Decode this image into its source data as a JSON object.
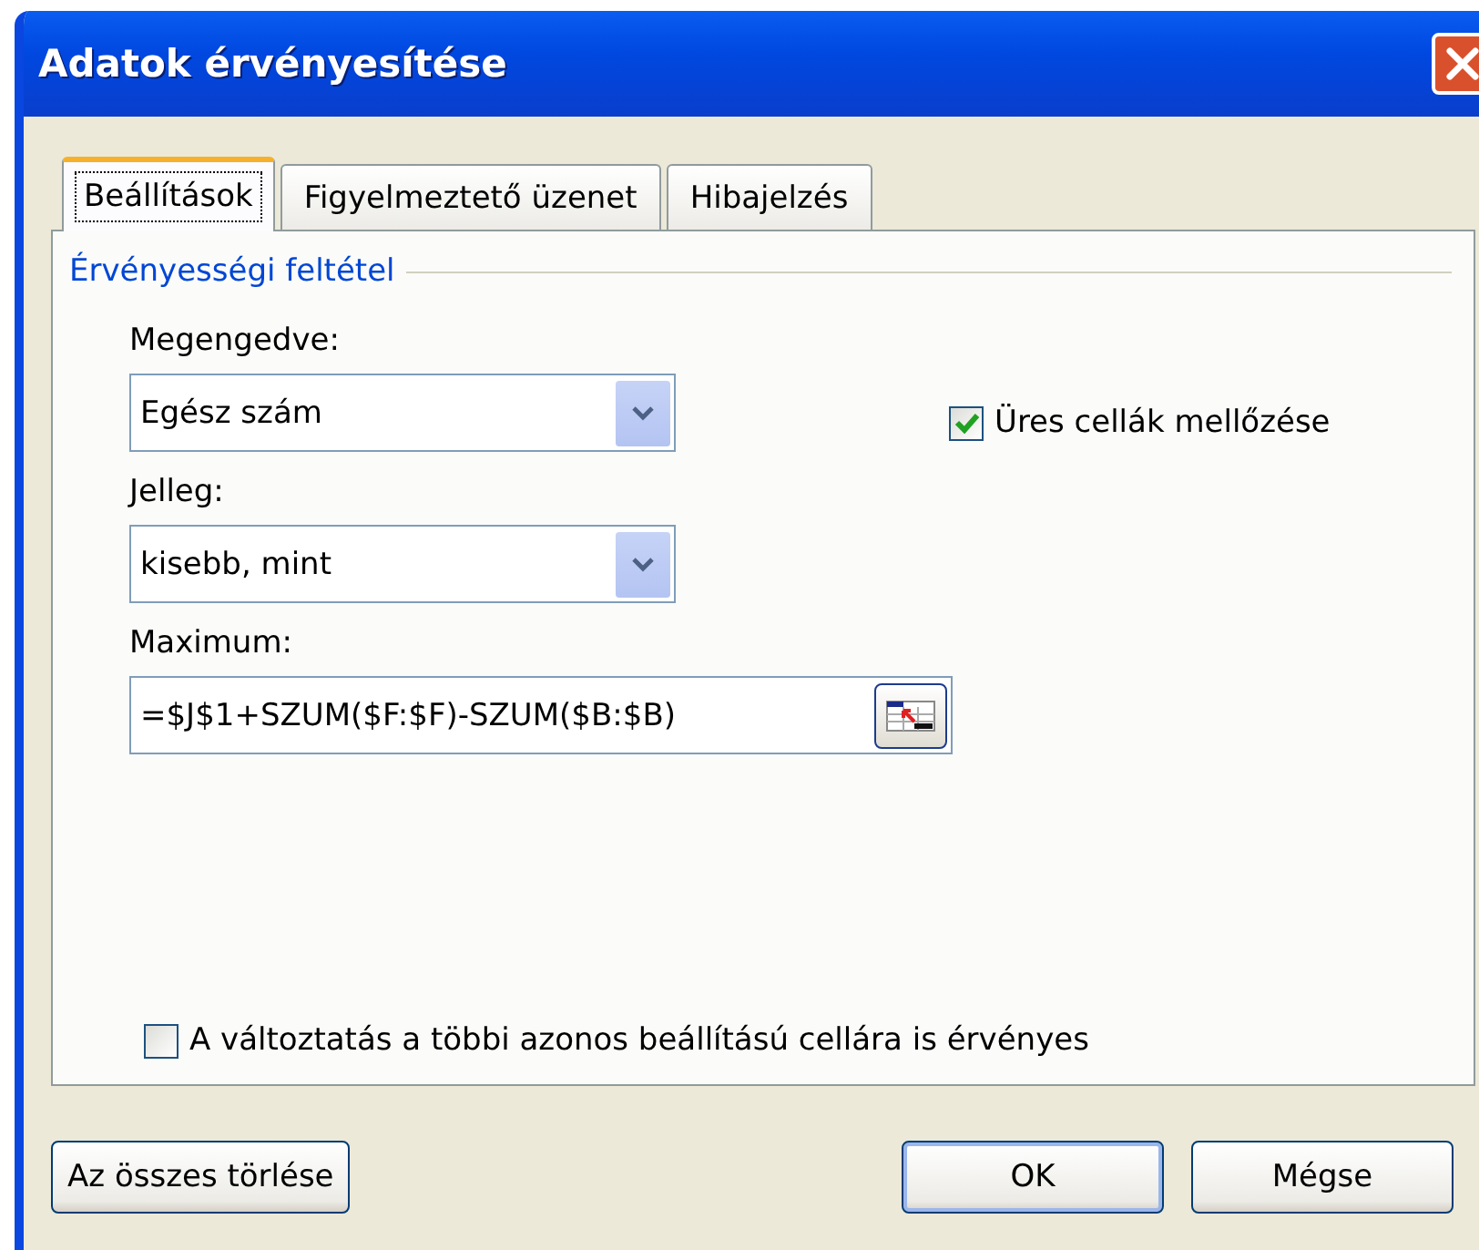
{
  "window": {
    "title": "Adatok érvényesítése"
  },
  "tabs": [
    {
      "label": "Beállítások",
      "selected": true
    },
    {
      "label": "Figyelmeztető üzenet",
      "selected": false
    },
    {
      "label": "Hibajelzés",
      "selected": false
    }
  ],
  "group": {
    "title": "Érvényességi feltétel"
  },
  "allow": {
    "label": "Megengedve:",
    "value": "Egész szám"
  },
  "ignore_blank": {
    "label": "Üres cellák mellőzése",
    "checked": true
  },
  "data": {
    "label": "Jelleg:",
    "value": "kisebb, mint"
  },
  "maximum": {
    "label": "Maximum:",
    "value": "=$J$1+SZUM($F:$F)-SZUM($B:$B)"
  },
  "apply_all": {
    "label": "A változtatás a többi azonos beállítású cellára is érvényes",
    "checked": false
  },
  "buttons": [
    {
      "label": "Az összes törlése",
      "default": false
    },
    {
      "label": "OK",
      "default": true
    },
    {
      "label": "Mégse",
      "default": false
    }
  ]
}
